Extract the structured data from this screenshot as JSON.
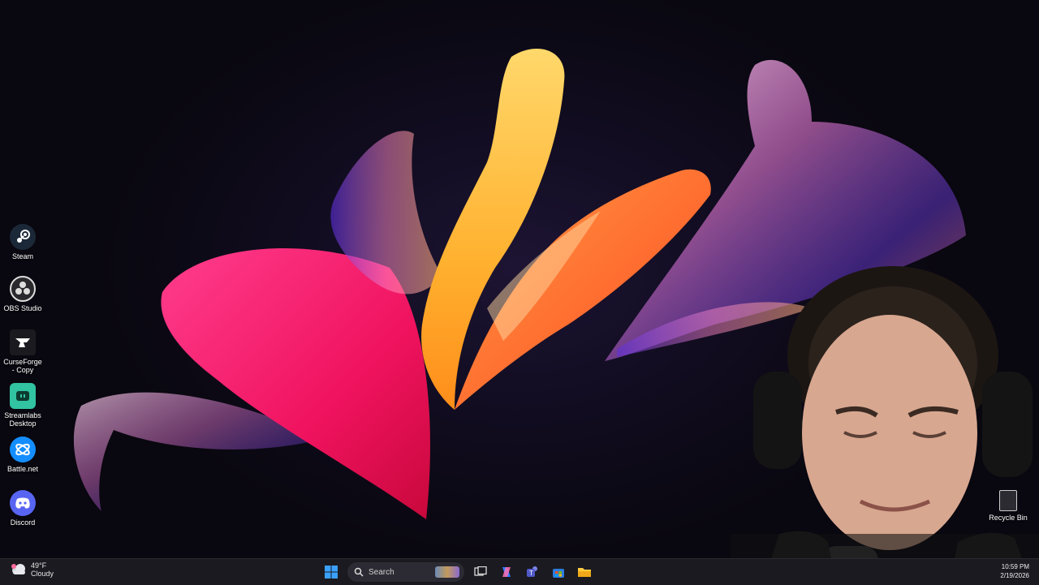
{
  "desktop": {
    "icons": [
      {
        "label": "Steam",
        "icon": "steam-icon",
        "color": "#1b2838"
      },
      {
        "label": "OBS Studio",
        "icon": "obs-icon",
        "color": "#2a2a2e"
      },
      {
        "label": "CurseForge - Copy",
        "icon": "curseforge-icon",
        "color": "#1b1b1f"
      },
      {
        "label": "Streamlabs Desktop",
        "icon": "streamlabs-icon",
        "color": "#31c3a2"
      },
      {
        "label": "Battle.net",
        "icon": "battlenet-icon",
        "color": "#148eff"
      },
      {
        "label": "Discord",
        "icon": "discord-icon",
        "color": "#5865f2"
      }
    ],
    "recycle_bin": {
      "label": "Recycle Bin",
      "icon": "recycle-bin-icon"
    }
  },
  "taskbar": {
    "weather": {
      "temp": "49°F",
      "condition": "Cloudy",
      "icon": "cloudy-icon"
    },
    "start_icon": "windows-start-icon",
    "search": {
      "label": "Search",
      "icon": "search-icon"
    },
    "pinned": [
      "task-view-icon",
      "copilot-icon",
      "teams-icon",
      "store-icon",
      "file-explorer-icon"
    ],
    "clock": {
      "time": "10:59 PM",
      "date": "2/19/2026"
    }
  },
  "colors": {
    "accent": "#0078d4",
    "taskbar_bg": "#1b1a20"
  }
}
